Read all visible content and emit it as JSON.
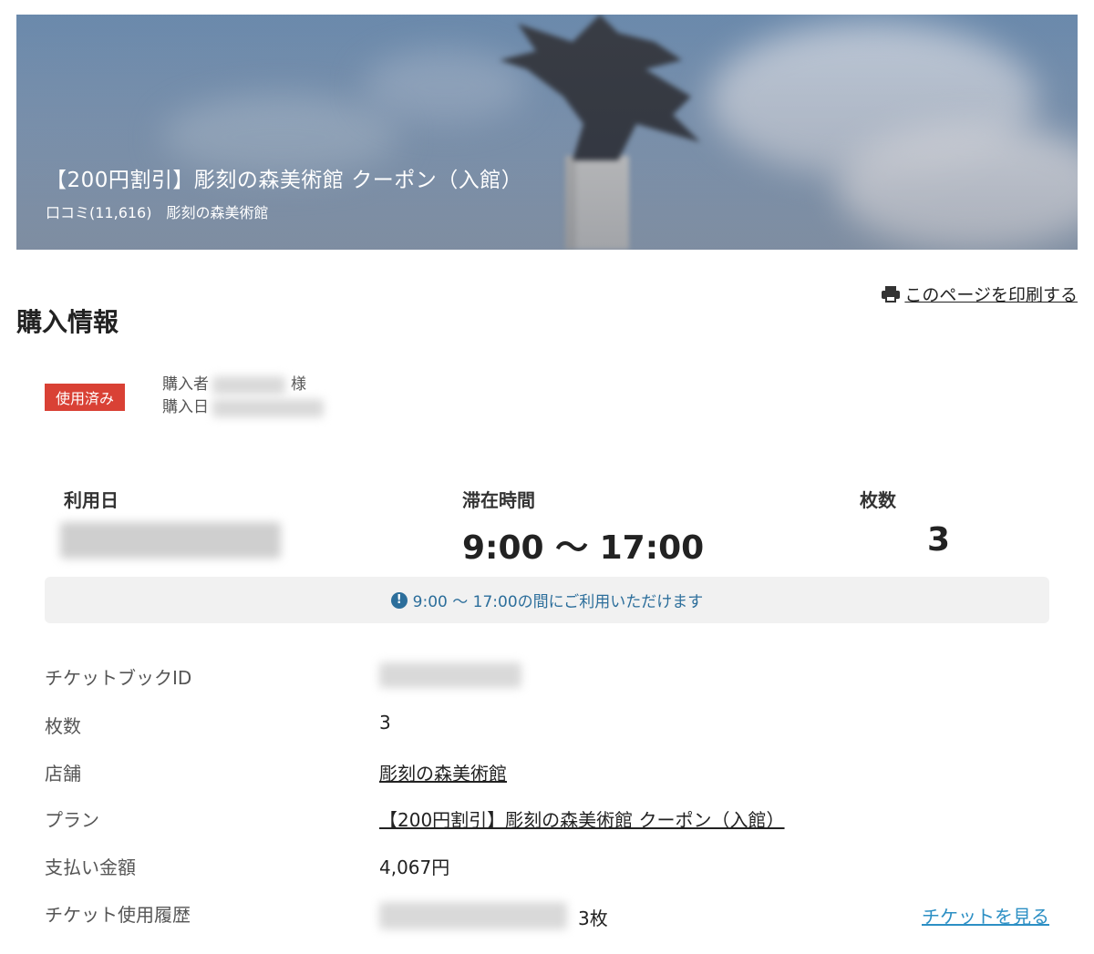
{
  "hero": {
    "title": "【200円割引】彫刻の森美術館 クーポン（入館）",
    "reviews": "口コミ(11,616)",
    "venue": "彫刻の森美術館"
  },
  "print_label": "このページを印刷する",
  "section_title": "購入情報",
  "status_badge": "使用済み",
  "buyer": {
    "name_label": "購入者",
    "honorific": "様",
    "date_label": "購入日"
  },
  "summary": {
    "use_date_label": "利用日",
    "stay_label": "滞在時間",
    "stay_value": "9:00 〜 17:00",
    "count_label": "枚数",
    "count_value": "3"
  },
  "notice": "9:00 〜 17:00の間にご利用いただけます",
  "details": {
    "ticketbook_label": "チケットブックID",
    "count_label": "枚数",
    "count_value": "3",
    "store_label": "店舗",
    "store_value": "彫刻の森美術館",
    "plan_label": "プラン",
    "plan_value": "【200円割引】彫刻の森美術館 クーポン（入館）",
    "amount_label": "支払い金額",
    "amount_value": "4,067円",
    "history_label": "チケット使用履歴",
    "history_count": "3枚",
    "view_tickets": "チケットを見る"
  },
  "colors": {
    "badge": "#d94135",
    "link": "#2c8fc4",
    "notice_bg": "#f1f1f1"
  }
}
